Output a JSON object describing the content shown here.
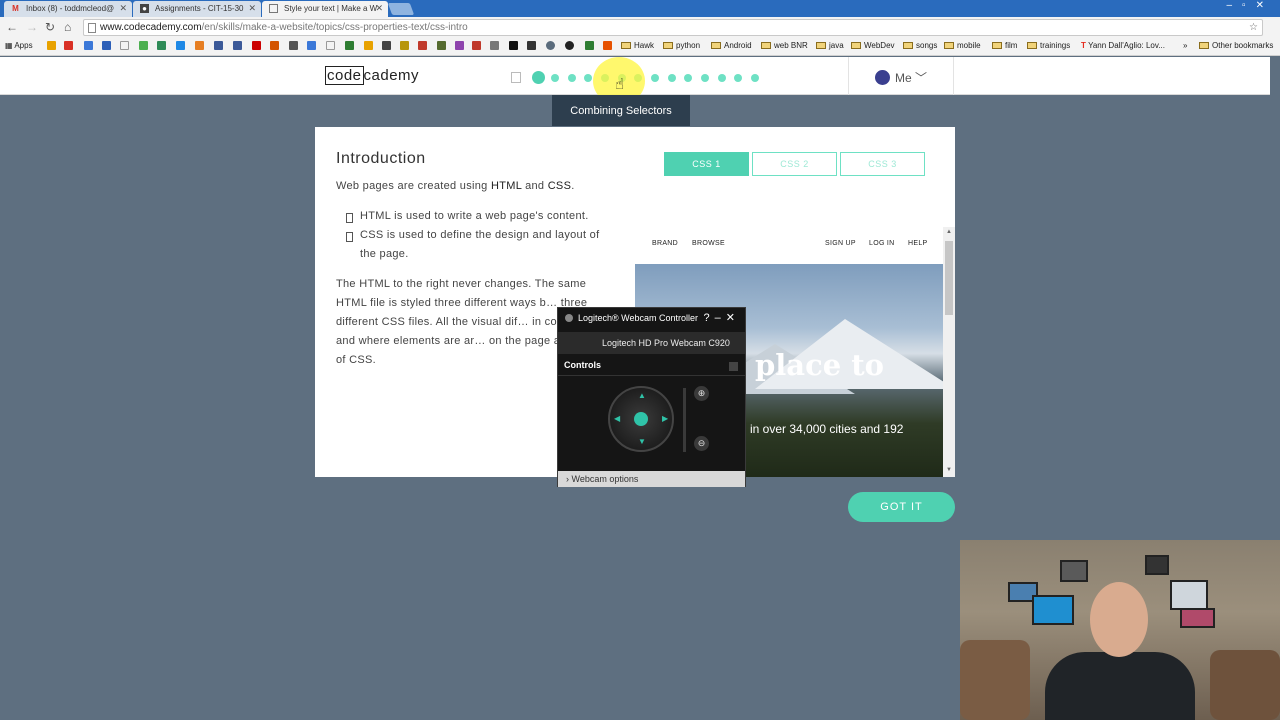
{
  "browser": {
    "tabs": [
      {
        "label": "Inbox (8) - toddmcleod@",
        "icon": "gmail-icon"
      },
      {
        "label": "Assignments - CIT-15-30",
        "icon": "canvas-icon"
      },
      {
        "label": "Style your text | Make a W",
        "icon": "page-icon"
      }
    ],
    "url_host": "www.codecademy.com",
    "url_path": "/en/skills/make-a-website/topics/css-properties-text/css-intro",
    "bookmarks": [
      "Apps",
      "Hawk",
      "python",
      "Android",
      "web BNR",
      "java",
      "WebDev",
      "songs",
      "mobile",
      "film",
      "trainings",
      "Yann Dall'Aglio: Lov...",
      "»",
      "Other bookmarks"
    ]
  },
  "header": {
    "logo_box": "code",
    "logo_rest": "cademy",
    "me_label": "Me",
    "tooltip": "Combining Selectors",
    "progress_total_dots": 14,
    "progress_current_dot": 1
  },
  "lesson": {
    "title": "Introduction",
    "intro_pre": "Web pages are created using ",
    "intro_html": "HTML",
    "intro_and": " and ",
    "intro_css": "CSS",
    "intro_post": ".",
    "bullets": [
      "HTML is used to write a web page's content.",
      "CSS is used to define the design and layout of the page."
    ],
    "paragraph": "The HTML to the right never changes. The same HTML file is styled three different ways b… three different CSS files. All the visual dif… in color, font, and where elements are ar… on the page are a result of CSS."
  },
  "css_tabs": [
    "CSS 1",
    "CSS 2",
    "CSS 3"
  ],
  "preview": {
    "nav_left": [
      "BRAND",
      "BROWSE"
    ],
    "nav_right": [
      "SIGN UP",
      "LOG IN",
      "HELP"
    ],
    "hero_big": "place to",
    "hero_small": "in over 34,000 cities and 192"
  },
  "webcam_controller": {
    "title": "Logitech® Webcam Controller",
    "camera": "Logitech HD Pro Webcam C920",
    "section": "Controls",
    "options": "Webcam options"
  },
  "got_it": "GOT IT",
  "colors": {
    "accent": "#4fd1b1",
    "background": "#5e6f80",
    "tooltip": "#2d3e4e"
  }
}
